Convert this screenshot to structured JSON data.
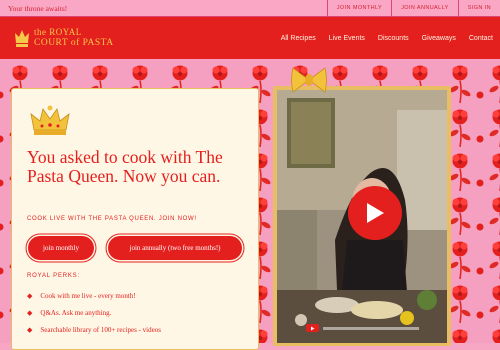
{
  "topbar": {
    "announcement": "Your throne awaits!",
    "links": [
      "JOIN MONTHLY",
      "JOIN ANNUALLY",
      "SIGN IN"
    ]
  },
  "brand": {
    "line1": "the ROYAL",
    "line2": "COURT of PASTA",
    "colors": {
      "red": "#e4201e",
      "gold": "#f6c84a",
      "pink": "#f7a6c4",
      "cream": "#fff7e6"
    }
  },
  "nav": {
    "links": [
      "All Recipes",
      "Live Events",
      "Discounts",
      "Giveaways",
      "Contact"
    ]
  },
  "hero": {
    "headline": "You asked to cook with The Pasta Queen. Now you can.",
    "subhead": "COOK LIVE WITH THE PASTA QUEEN. JOIN NOW!",
    "buttons": {
      "monthly": "join monthly",
      "annual": "join annually (two free months!)"
    },
    "perks_title": "ROYAL PERKS:",
    "perks": [
      "Cook with me live - every month!",
      "Q&As. Ask me anything.",
      "Searchable library of 100+ recipes - videos"
    ]
  },
  "video": {
    "icons": [
      "play-icon",
      "youtube-icon"
    ],
    "progress": 0
  }
}
